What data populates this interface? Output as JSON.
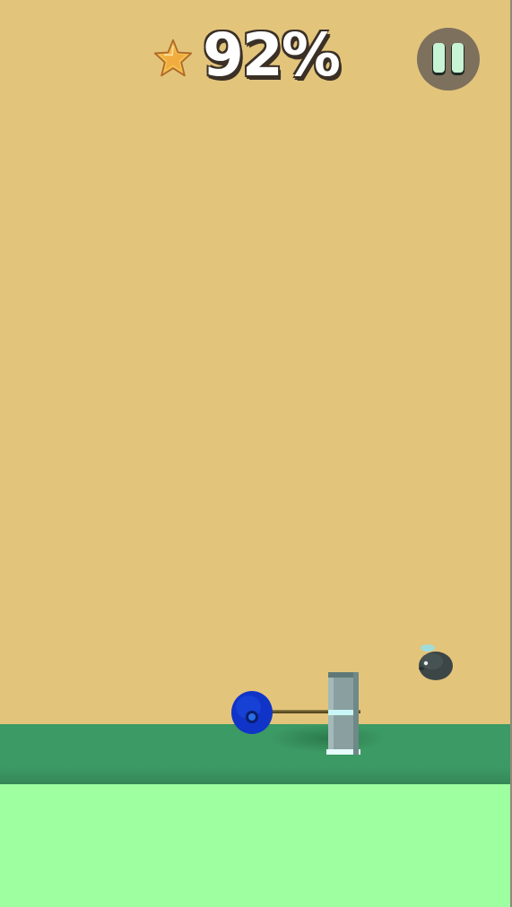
{
  "hud": {
    "progress_text": "92%",
    "progress_value": 92,
    "star_icon": "star-icon",
    "pause_icon": "pause-icon"
  },
  "colors": {
    "sky": "#e3c47b",
    "ground_top": "#3c9a64",
    "ground_bottom": "#9dff9f",
    "player": "#1034c8",
    "hammer_shaft": "#5a4a22",
    "hammer_head": "#8fa6a6",
    "hammer_highlight": "#c9f6f6",
    "enemy": "#3c4646",
    "pause_bg": "#7d705d",
    "pause_fg": "#c9f3d5",
    "star": "#f2a33b"
  },
  "objects": {
    "player": "player-ball",
    "weapon": "hammer",
    "enemy": "fly-enemy"
  }
}
